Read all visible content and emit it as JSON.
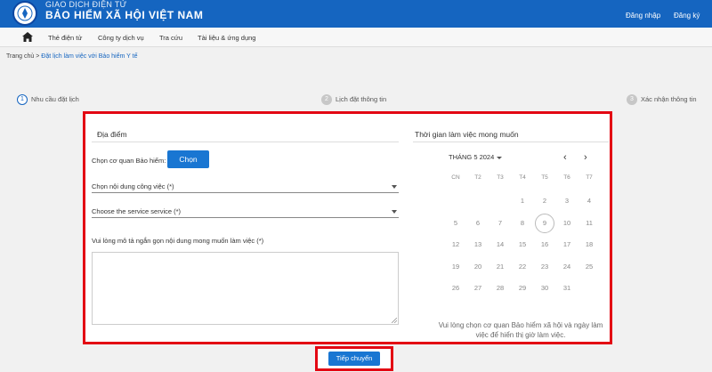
{
  "header": {
    "brand_top": "GIAO DỊCH ĐIỆN TỬ",
    "brand_main": "BẢO HIỂM XÃ HỘI VIỆT NAM",
    "login": "Đăng nhập",
    "register": "Đăng ký"
  },
  "nav": {
    "items": [
      "Thẻ điện tử",
      "Công ty dịch vụ",
      "Tra cứu",
      "Tài liệu & ứng dụng"
    ]
  },
  "breadcrumb": {
    "home": "Trang chủ",
    "sep": ">",
    "current": "Đặt lịch làm việc với Bảo hiểm Y tế"
  },
  "steps": [
    {
      "num": "1",
      "label": "Nhu cầu đặt lịch"
    },
    {
      "num": "2",
      "label": "Lịch đặt thông tin"
    },
    {
      "num": "3",
      "label": "Xác nhận thông tin"
    }
  ],
  "form": {
    "section_title": "Địa điểm",
    "agency_label": "Chọn cơ quan Bảo hiểm:",
    "choose_button": "Chọn",
    "work_content_select": "Chọn nội dung công việc (*)",
    "service_select": "Choose the service service (*)",
    "description_label": "Vui lòng mô tả ngắn gọn nội dung mong muốn làm việc (*)"
  },
  "calendar": {
    "section_title": "Thời gian làm việc mong muốn",
    "month_label": "THÁNG 5 2024",
    "prev": "‹",
    "next": "›",
    "weekdays": [
      "CN",
      "T2",
      "T3",
      "T4",
      "T5",
      "T6",
      "T7"
    ],
    "weeks": [
      [
        "",
        "",
        "",
        "1",
        "2",
        "3",
        "4"
      ],
      [
        "5",
        "6",
        "7",
        "8",
        "9",
        "10",
        "11"
      ],
      [
        "12",
        "13",
        "14",
        "15",
        "16",
        "17",
        "18"
      ],
      [
        "19",
        "20",
        "21",
        "22",
        "23",
        "24",
        "25"
      ],
      [
        "26",
        "27",
        "28",
        "29",
        "30",
        "31",
        ""
      ]
    ],
    "today": "9",
    "note": "Vui lòng chọn cơ quan Bảo hiểm xã hội và ngày làm việc để hiển thị giờ làm việc."
  },
  "footer": {
    "next_button": "Tiếp chuyển"
  },
  "colors": {
    "header": "#1565c0",
    "accent": "#1976d2",
    "highlight": "#e30613"
  }
}
